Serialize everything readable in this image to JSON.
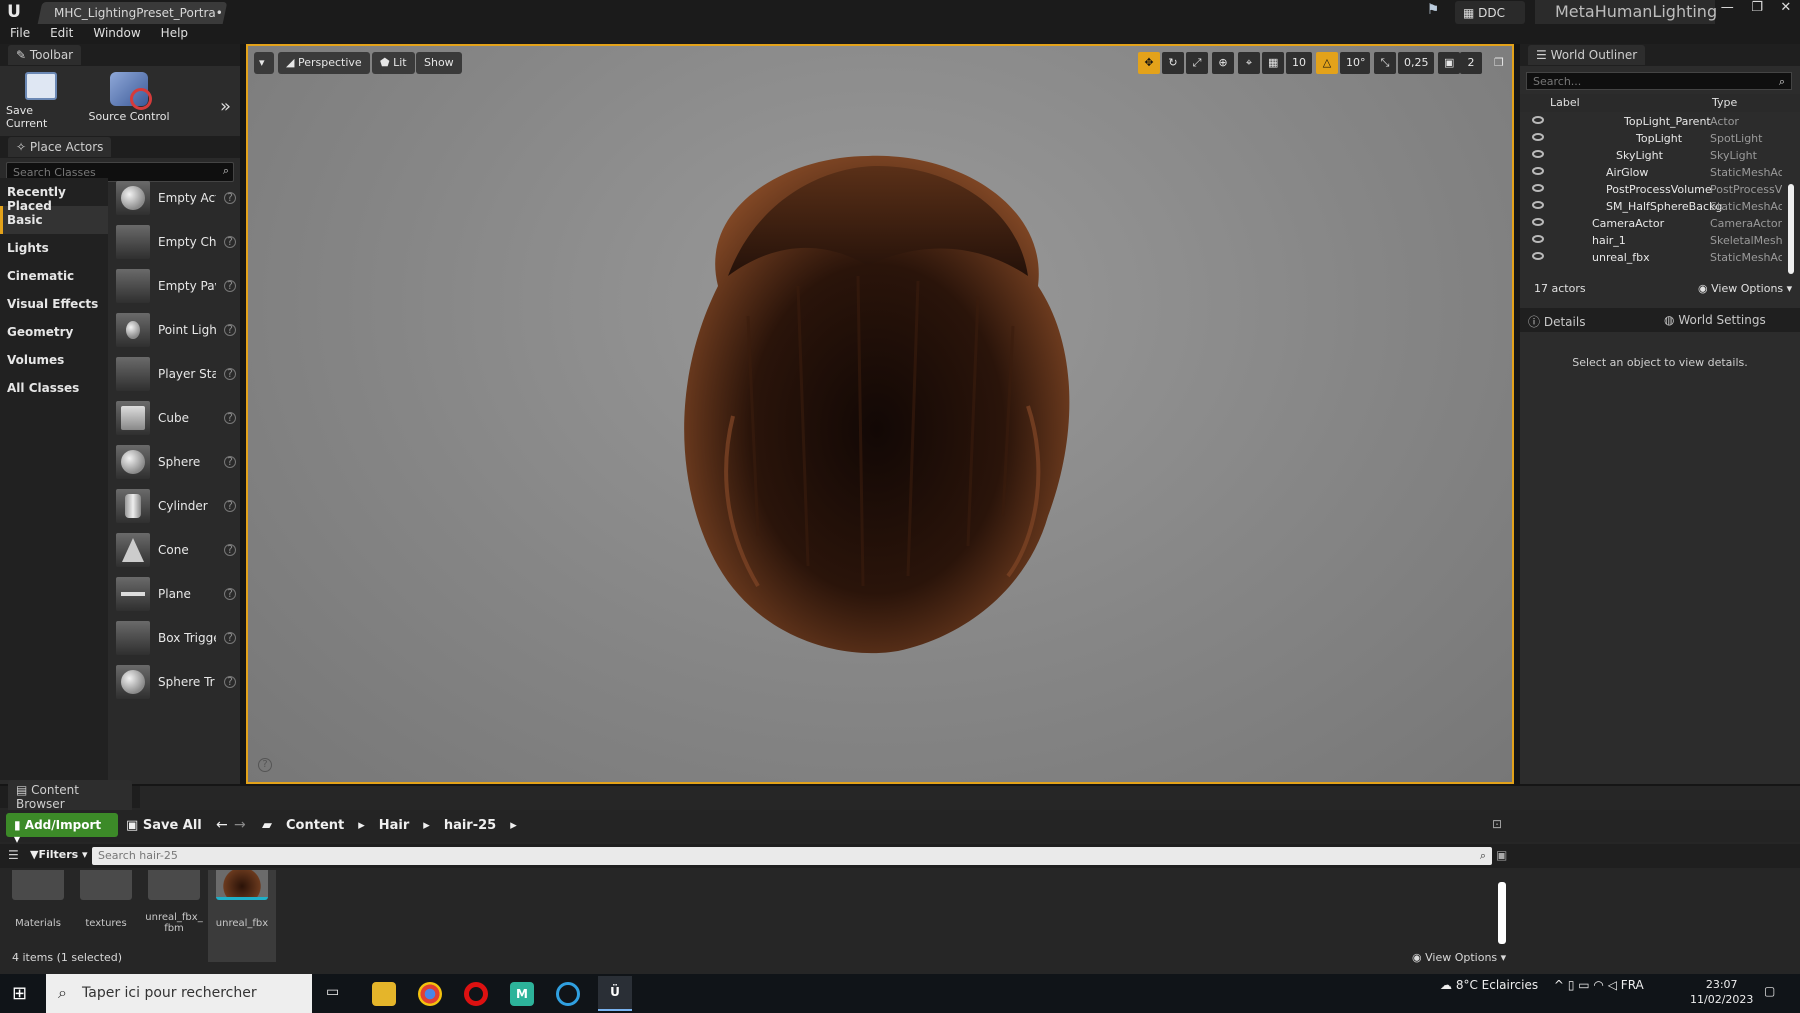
{
  "window": {
    "doc_tab": "MHC_LightingPreset_Portra•",
    "ddc": "DDC",
    "project": "MetaHumanLighting"
  },
  "menu": [
    "File",
    "Edit",
    "Window",
    "Help"
  ],
  "toolbar": {
    "tab_label": "Toolbar",
    "save_current": "Save Current",
    "source_control": "Source Control"
  },
  "place_actors": {
    "tab_label": "Place Actors",
    "search_placeholder": "Search Classes",
    "categories": [
      "Recently Placed",
      "Basic",
      "Lights",
      "Cinematic",
      "Visual Effects",
      "Geometry",
      "Volumes",
      "All Classes"
    ],
    "selected_category": "Basic",
    "items": [
      "Empty Act",
      "Empty Cha",
      "Empty Pav",
      "Point Light",
      "Player Sta",
      "Cube",
      "Sphere",
      "Cylinder",
      "Cone",
      "Plane",
      "Box Trigge",
      "Sphere Tr"
    ]
  },
  "viewport": {
    "perspective": "Perspective",
    "lit": "Lit",
    "show": "Show",
    "grid_snap": "10",
    "rot_snap": "10°",
    "scale_snap": "0,25",
    "camera_speed": "2"
  },
  "outliner": {
    "tab_label": "World Outliner",
    "search_placeholder": "Search...",
    "col_label": "Label",
    "col_type": "Type",
    "rows": [
      {
        "label": "TopLight_Parent",
        "type": "Actor"
      },
      {
        "label": "TopLight",
        "type": "SpotLight"
      },
      {
        "label": "SkyLight",
        "type": "SkyLight"
      },
      {
        "label": "AirGlow",
        "type": "StaticMeshAc"
      },
      {
        "label": "PostProcessVolume",
        "type": "PostProcessV"
      },
      {
        "label": "SM_HalfSphereBackg",
        "type": "StaticMeshAc"
      },
      {
        "label": "CameraActor",
        "type": "CameraActor"
      },
      {
        "label": "hair_1",
        "type": "SkeletalMesh"
      },
      {
        "label": "unreal_fbx",
        "type": "StaticMeshAc"
      }
    ],
    "count": "17 actors",
    "view_options": "View Options"
  },
  "details": {
    "tab_details": "Details",
    "tab_world": "World Settings",
    "empty_text": "Select an object to view details."
  },
  "content_browser": {
    "tab_label": "Content Browser",
    "add_import": "Add/Import",
    "save_all": "Save All",
    "crumbs": [
      "Content",
      "Hair",
      "hair-25"
    ],
    "filters": "Filters",
    "search_placeholder": "Search hair-25",
    "assets": [
      "Materials",
      "textures",
      "unreal_fbx_\nfbm",
      "unreal_fbx"
    ],
    "count": "4 items (1 selected)",
    "view_options": "View Options"
  },
  "taskbar": {
    "search_placeholder": "Taper ici pour rechercher",
    "weather": "8°C  Eclaircies",
    "lang": "FRA",
    "time": "23:07",
    "date": "11/02/2023"
  },
  "colors": {
    "accent": "#e3a21a",
    "add_green": "#3c8a28"
  }
}
